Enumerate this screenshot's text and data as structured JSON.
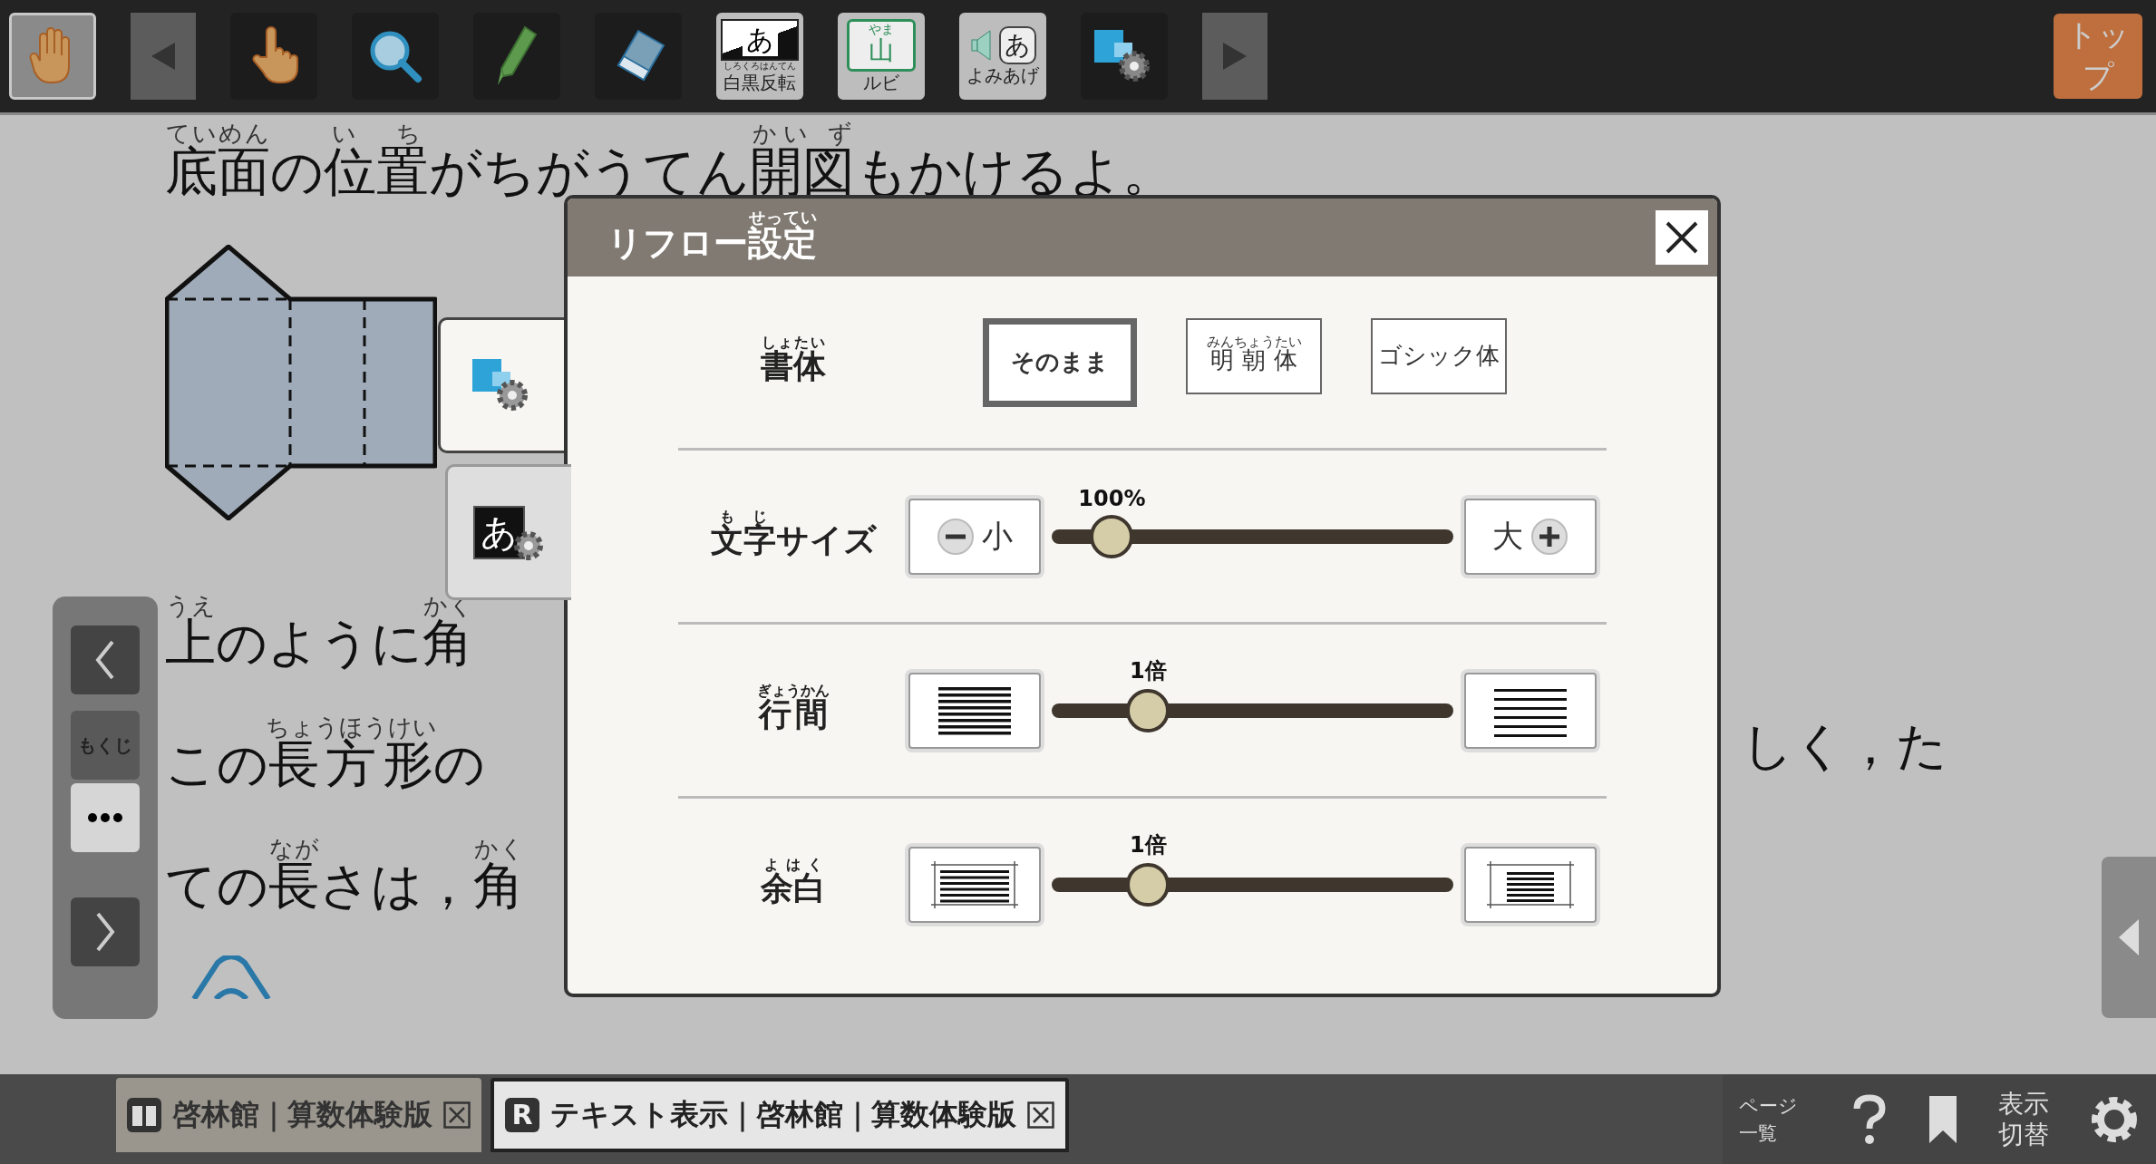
{
  "toolbar": {
    "items": [
      {
        "kind": "hand",
        "selected": true
      },
      {
        "kind": "prev",
        "selected": false
      },
      {
        "kind": "pointer",
        "selected": false
      },
      {
        "kind": "magnifier",
        "selected": false
      },
      {
        "kind": "pen",
        "selected": false
      },
      {
        "kind": "eraser",
        "selected": false
      },
      {
        "kind": "invert",
        "glyph": "あ",
        "ruby": "しろくろはんてん",
        "label": "白黒反転",
        "selected": false
      },
      {
        "kind": "ruby",
        "glyph": "山",
        "ruby": "やま",
        "label": "ルビ",
        "selected": false
      },
      {
        "kind": "read",
        "glyph": "あ",
        "label": "よみあげ",
        "selected": false
      },
      {
        "kind": "reflow",
        "selected": false
      },
      {
        "kind": "next",
        "selected": false
      }
    ],
    "top_button": "トップ"
  },
  "page": {
    "lines": [
      {
        "segments": [
          {
            "text": "底面",
            "ruby": "ていめん"
          },
          {
            "text": "の"
          },
          {
            "text": "位置",
            "ruby": "い ち"
          },
          {
            "text": "がちがうてん"
          },
          {
            "text": "開図",
            "ruby": "かい ず"
          },
          {
            "text": "もかけるよ。"
          }
        ]
      },
      {
        "segments": [
          {
            "text": "上",
            "ruby": "うえ"
          },
          {
            "text": "のように"
          },
          {
            "text": "角",
            "ruby": "かく"
          }
        ]
      },
      {
        "segments": [
          {
            "text": "この"
          },
          {
            "text": "長方形",
            "ruby": "ちょうほうけい"
          },
          {
            "text": "の"
          }
        ],
        "right_segments": [
          {
            "text": "しく，た"
          }
        ]
      },
      {
        "segments": [
          {
            "text": "ての"
          },
          {
            "text": "長",
            "ruby": "なが"
          },
          {
            "text": "さは，"
          },
          {
            "text": "角",
            "ruby": "かく"
          }
        ]
      }
    ],
    "nav": [
      {
        "kind": "prev"
      },
      {
        "kind": "contents",
        "label": "もくじ"
      },
      {
        "kind": "more"
      },
      {
        "kind": "next"
      }
    ]
  },
  "side_tabs": [
    {
      "kind": "reflow",
      "selected": true
    },
    {
      "kind": "invert",
      "glyph": "あ",
      "selected": false
    }
  ],
  "dialog": {
    "title": [
      {
        "text": "リフロー"
      },
      {
        "text": "設定",
        "ruby": "せってい"
      }
    ],
    "rows": [
      {
        "kind": "options",
        "label": [
          {
            "text": "書体",
            "ruby": "しょたい"
          }
        ],
        "options": [
          {
            "segments": [
              {
                "text": "そのまま"
              }
            ],
            "selected": true
          },
          {
            "segments": [
              {
                "text": "明朝体",
                "ruby": "みんちょうたい"
              }
            ],
            "selected": false
          },
          {
            "segments": [
              {
                "text": "ゴシック体"
              }
            ],
            "selected": false
          }
        ]
      },
      {
        "kind": "slider",
        "label": [
          {
            "text": "文字",
            "ruby": "もじ"
          },
          {
            "text": "サイズ"
          }
        ],
        "left": {
          "kind": "smaller",
          "text": "小"
        },
        "right": {
          "kind": "larger",
          "text": "大"
        },
        "reading": "100%",
        "level": 0.15
      },
      {
        "kind": "slider",
        "label": [
          {
            "text": "行間",
            "ruby": "ぎょうかん"
          }
        ],
        "left": {
          "kind": "narrow-spacing"
        },
        "right": {
          "kind": "wide-spacing"
        },
        "reading": "1倍",
        "level": 0.24
      },
      {
        "kind": "slider",
        "label": [
          {
            "text": "余白",
            "ruby": "よはく"
          }
        ],
        "left": {
          "kind": "narrow-margin"
        },
        "right": {
          "kind": "wide-margin"
        },
        "reading": "1倍",
        "level": 0.24
      }
    ]
  },
  "bottom_bar": {
    "tabs": [
      {
        "kind": "book",
        "label": "啓林館｜算数体験版",
        "selected": false
      },
      {
        "kind": "text",
        "badge": "R",
        "label": "テキスト表示｜啓林館｜算数体験版",
        "selected": true
      }
    ],
    "tools": [
      {
        "kind": "page-list",
        "lines": [
          "ページ",
          "一覧"
        ]
      },
      {
        "kind": "help"
      },
      {
        "kind": "bookmark"
      },
      {
        "kind": "display",
        "lines": [
          "表示",
          "切替"
        ]
      },
      {
        "kind": "settings"
      }
    ]
  }
}
